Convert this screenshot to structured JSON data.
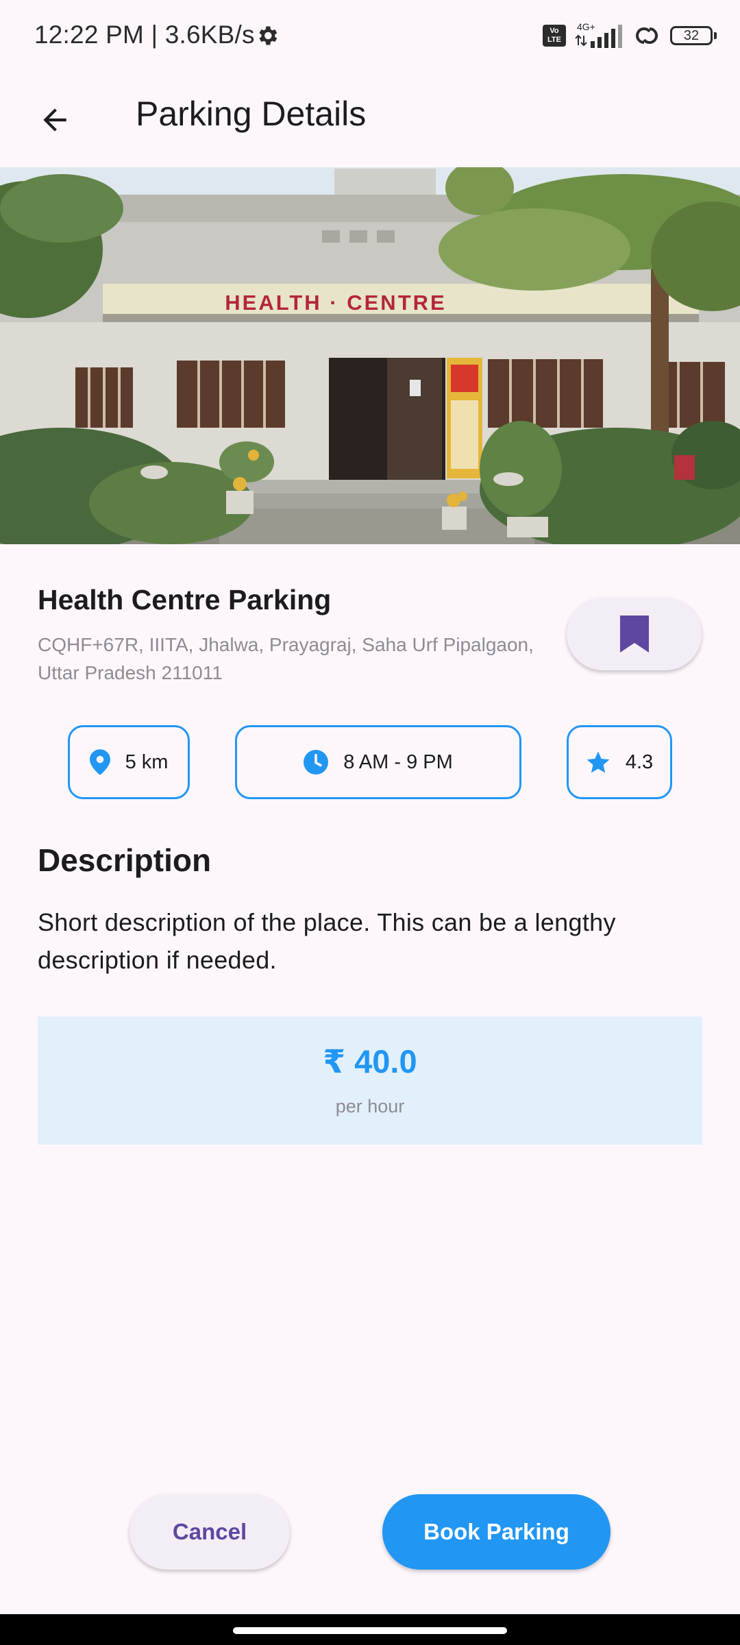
{
  "status_bar": {
    "time_speed": "12:22 PM | 3.6KB/s",
    "network": "4G+",
    "volte": "Vo LTE",
    "battery": "32"
  },
  "app_bar": {
    "title": "Parking Details"
  },
  "hero": {
    "sign_text": "HEALTH · CENTRE"
  },
  "place": {
    "name": "Health Centre Parking",
    "address": "CQHF+67R, IIITA, Jhalwa, Prayagraj, Saha Urf Pipalgaon, Uttar Pradesh 211011"
  },
  "chips": {
    "distance": "5 km",
    "hours": "8 AM - 9 PM",
    "rating": "4.3"
  },
  "description": {
    "heading": "Description",
    "text": "Short description of the place. This can be a lengthy description if needed."
  },
  "pricing": {
    "price": "₹ 40.0",
    "unit": "per hour"
  },
  "actions": {
    "cancel_label": "Cancel",
    "book_label": "Book Parking"
  },
  "colors": {
    "accent": "#2196f3",
    "bookmark": "#5e47a0",
    "background": "#fdf7fc",
    "price_box": "#e1f0fb"
  },
  "icons": [
    "settings-gear-icon",
    "volte-icon",
    "signal-icon",
    "hotspot-link-icon",
    "battery-icon",
    "back-arrow-icon",
    "bookmark-icon",
    "location-pin-icon",
    "clock-icon",
    "star-icon"
  ]
}
